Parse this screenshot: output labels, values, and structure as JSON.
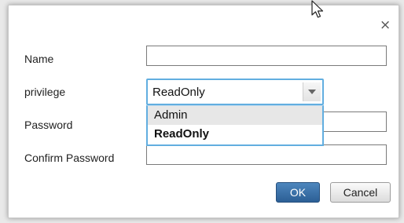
{
  "dialog": {
    "close_glyph": "×",
    "fields": {
      "name_label": "Name",
      "name_value": "",
      "privilege_label": "privilege",
      "privilege_value": "ReadOnly",
      "privilege_options": [
        "Admin",
        "ReadOnly"
      ],
      "password_label": "Password",
      "password_value": "",
      "confirm_label": "Confirm Password",
      "confirm_value": ""
    },
    "buttons": {
      "ok_label": "OK",
      "cancel_label": "Cancel"
    }
  },
  "colors": {
    "focus_border": "#62aee0",
    "primary_button": "#2c5f95"
  },
  "icons": [
    "close-icon",
    "dropdown-arrow-icon",
    "mouse-pointer-icon"
  ]
}
